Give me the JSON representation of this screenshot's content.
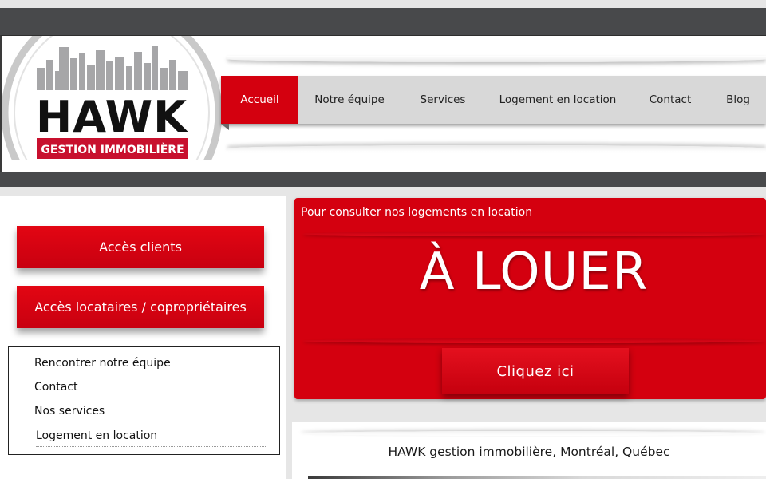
{
  "logo": {
    "brand": "HAWK",
    "tagline": "GESTION IMMOBILIÈRE"
  },
  "nav": {
    "items": [
      {
        "label": "Accueil",
        "active": true
      },
      {
        "label": "Notre équipe"
      },
      {
        "label": "Services"
      },
      {
        "label": "Logement en location"
      },
      {
        "label": "Contact"
      },
      {
        "label": "Blog"
      }
    ]
  },
  "sidebar": {
    "client_button": "Accès clients",
    "tenant_button": "Accès locataires / copropriétaires",
    "links": [
      "Rencontrer notre équipe",
      "Contact",
      "Nos services",
      "Logement en location"
    ]
  },
  "promo": {
    "caption": "Pour consulter nos logements en location",
    "headline": "À LOUER",
    "cta": "Cliquez ici"
  },
  "main": {
    "heading": "HAWK gestion immobilière, Montréal, Québec"
  },
  "colors": {
    "brand_red": "#d4000f",
    "dark_bar": "#48494b",
    "nav_gray": "#d8d8d8"
  }
}
